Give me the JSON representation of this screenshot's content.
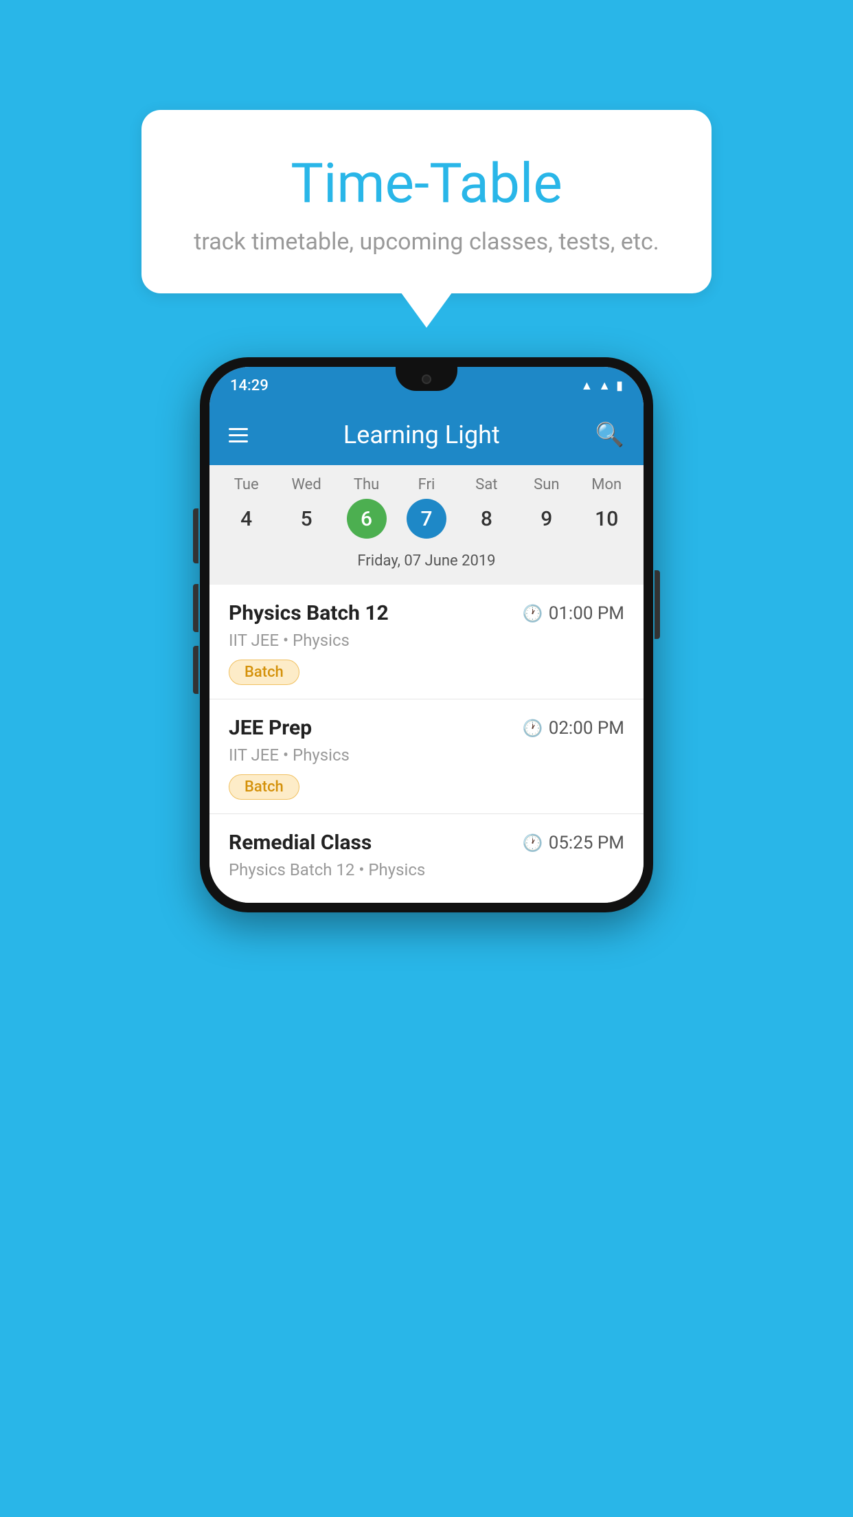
{
  "background_color": "#29b6e8",
  "speech_bubble": {
    "title": "Time-Table",
    "subtitle": "track timetable, upcoming classes, tests, etc."
  },
  "phone": {
    "status_bar": {
      "time": "14:29"
    },
    "app_bar": {
      "title": "Learning Light"
    },
    "calendar": {
      "days": [
        {
          "label": "Tue",
          "num": "4",
          "state": "normal"
        },
        {
          "label": "Wed",
          "num": "5",
          "state": "normal"
        },
        {
          "label": "Thu",
          "num": "6",
          "state": "today"
        },
        {
          "label": "Fri",
          "num": "7",
          "state": "selected"
        },
        {
          "label": "Sat",
          "num": "8",
          "state": "normal"
        },
        {
          "label": "Sun",
          "num": "9",
          "state": "normal"
        },
        {
          "label": "Mon",
          "num": "10",
          "state": "normal"
        }
      ],
      "selected_date_label": "Friday, 07 June 2019"
    },
    "schedule": [
      {
        "title": "Physics Batch 12",
        "time": "01:00 PM",
        "subtitle": "IIT JEE • Physics",
        "badge": "Batch"
      },
      {
        "title": "JEE Prep",
        "time": "02:00 PM",
        "subtitle": "IIT JEE • Physics",
        "badge": "Batch"
      },
      {
        "title": "Remedial Class",
        "time": "05:25 PM",
        "subtitle": "Physics Batch 12 • Physics",
        "badge": null
      }
    ]
  }
}
